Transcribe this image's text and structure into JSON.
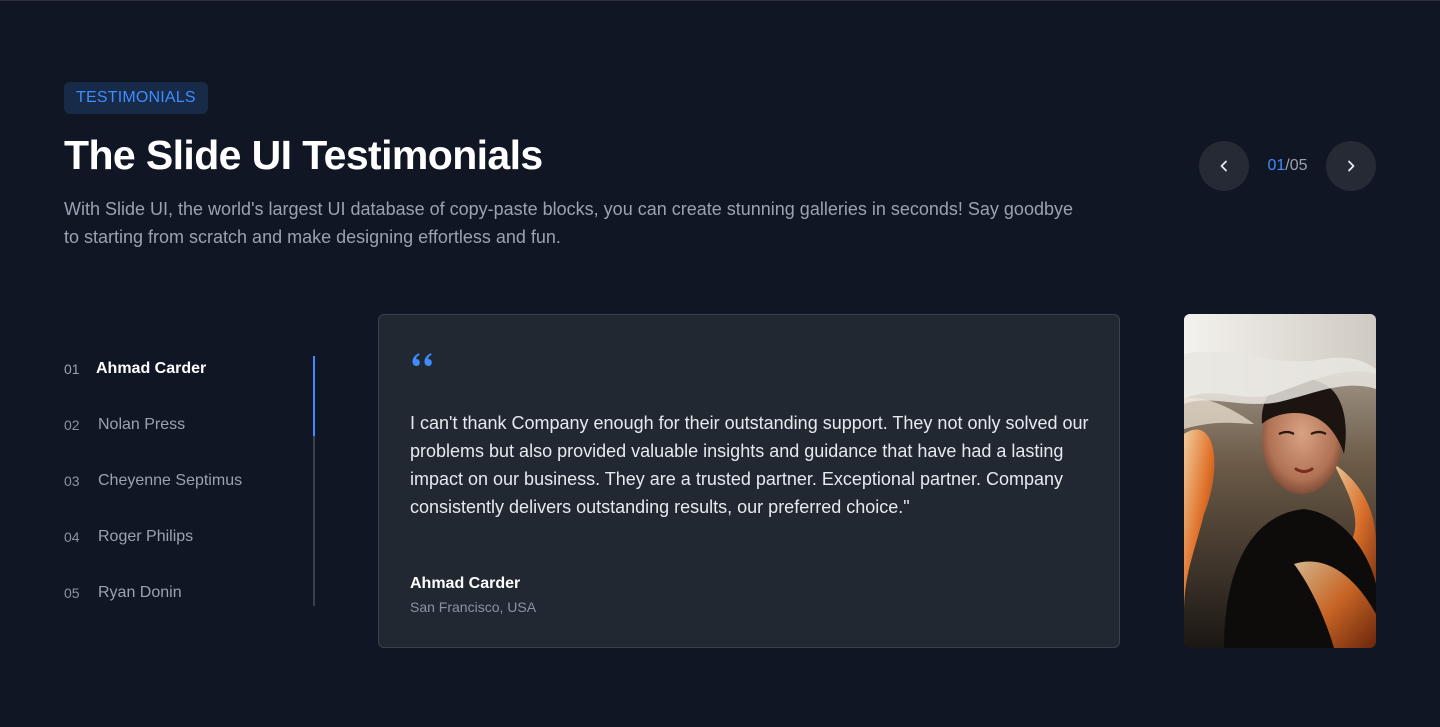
{
  "header": {
    "badge": "TESTIMONIALS",
    "title": "The Slide UI Testimonials",
    "subtitle": "With Slide UI, the world's largest UI database of copy-paste blocks, you can create stunning galleries in seconds! Say goodbye to starting from scratch and make designing effortless and fun."
  },
  "nav": {
    "prev_icon": "chevron-left-icon",
    "next_icon": "chevron-right-icon",
    "current": "01",
    "total": "/05"
  },
  "people": [
    {
      "num": "01",
      "name": "Ahmad Carder"
    },
    {
      "num": "02",
      "name": "Nolan Press"
    },
    {
      "num": "03",
      "name": "Cheyenne Septimus"
    },
    {
      "num": "04",
      "name": "Roger Philips"
    },
    {
      "num": "05",
      "name": "Ryan Donin"
    }
  ],
  "progress": {
    "active_index": 1,
    "fraction": 0.32
  },
  "testimonial": {
    "quote_icon": "quote-icon",
    "text": "I can't thank Company enough for their outstanding support. They not only solved our problems but also provided valuable insights and guidance that have had a lasting impact on our business. They are a trusted partner. Exceptional partner. Company consistently delivers outstanding results, our preferred choice.\"",
    "author": "Ahmad Carder",
    "location": "San Francisco, USA"
  },
  "colors": {
    "background": "#111624",
    "accent": "#3f8cff",
    "card": "#222831"
  }
}
